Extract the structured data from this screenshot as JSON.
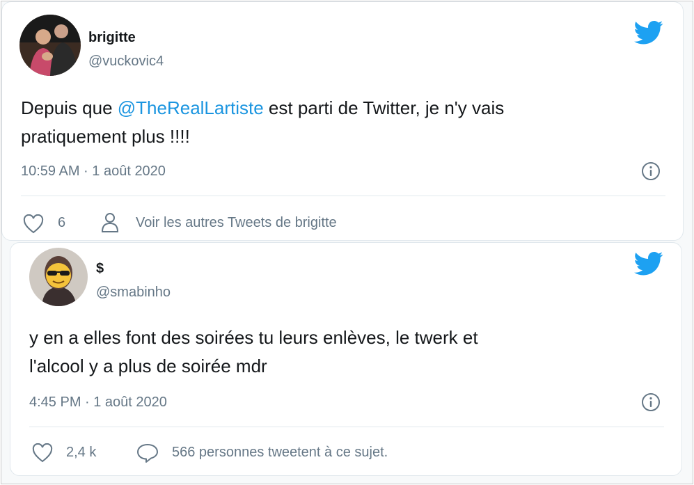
{
  "tweets": [
    {
      "name": "brigitte",
      "handle": "@vuckovic4",
      "text_before": "Depuis que ",
      "mention": "@TheRealLartiste",
      "text_after": " est parti de Twitter, je n'y vais\npratiquement plus !!!!",
      "timestamp": "10:59 AM · 1 août 2020",
      "likes": "6",
      "action_label": "Voir les autres Tweets de brigitte"
    },
    {
      "name": "$",
      "handle": "@smabinho",
      "text": "y en a elles font des soirées tu leurs enlèves, le twerk et\nl'alcool y a plus de soirée mdr",
      "timestamp": "4:45 PM · 1 août 2020",
      "likes": "2,4 k",
      "action_label": "566 personnes tweetent à ce sujet."
    }
  ],
  "icons": {
    "brand": "twitter-bird-icon",
    "info": "info-icon",
    "like": "heart-icon",
    "profile": "person-icon",
    "reply": "speech-bubble-icon"
  },
  "colors": {
    "brand_blue": "#1da1f2",
    "mention": "#1b95e0",
    "secondary_text": "#657786",
    "border": "#e1e8ed"
  }
}
